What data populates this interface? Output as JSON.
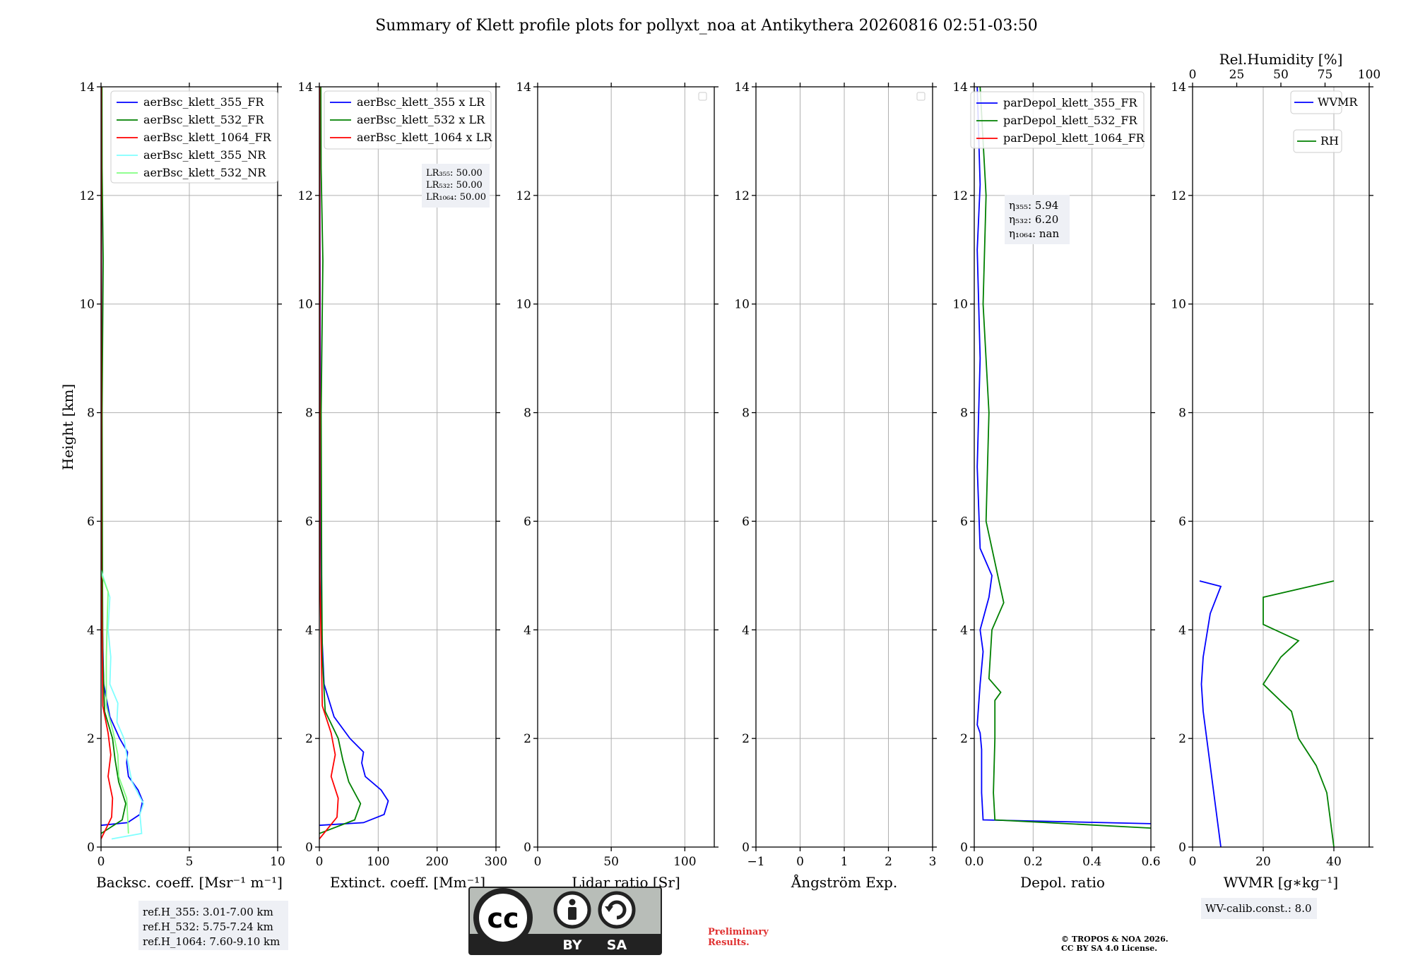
{
  "title": "Summary of Klett profile plots for pollyxt_noa at Antikythera 20260816 02:51-03:50",
  "y_axis_label": "Height [km]",
  "colors": {
    "blue": "#0000ff",
    "green": "#008000",
    "red": "#ff0000",
    "cyan": "#80ffff",
    "lightgreen": "#80ff80",
    "grid": "#b0b0b0"
  },
  "chart_data": [
    {
      "id": "backscatter",
      "type": "line",
      "xlabel": "Backsc. coeff. [Msr⁻¹ m⁻¹]",
      "ylabel": "Height [km]",
      "xlim": [
        0,
        10
      ],
      "ylim": [
        0,
        14
      ],
      "xticks": [
        0,
        5,
        10
      ],
      "yticks": [
        0,
        2,
        4,
        6,
        8,
        10,
        12,
        14
      ],
      "grid": true,
      "legend_position": "upper right",
      "series": [
        {
          "name": "aerBsc_klett_355_FR",
          "color": "#0000ff",
          "points": [
            [
              0.0,
              0.4
            ],
            [
              1.5,
              0.45
            ],
            [
              2.2,
              0.6
            ],
            [
              2.35,
              0.85
            ],
            [
              2.1,
              1.05
            ],
            [
              1.55,
              1.3
            ],
            [
              1.45,
              1.55
            ],
            [
              1.5,
              1.75
            ],
            [
              1.05,
              2.0
            ],
            [
              0.5,
              2.4
            ],
            [
              0.15,
              3.0
            ],
            [
              0.08,
              4.0
            ],
            [
              0.05,
              6.0
            ],
            [
              0.03,
              9.0
            ],
            [
              0.02,
              12.0
            ],
            [
              0.01,
              14.0
            ]
          ]
        },
        {
          "name": "aerBsc_klett_532_FR",
          "color": "#008000",
          "points": [
            [
              0.0,
              0.25
            ],
            [
              1.2,
              0.5
            ],
            [
              1.4,
              0.8
            ],
            [
              1.0,
              1.2
            ],
            [
              0.8,
              1.6
            ],
            [
              0.65,
              2.0
            ],
            [
              0.2,
              2.5
            ],
            [
              0.1,
              3.5
            ],
            [
              0.08,
              5.0
            ],
            [
              0.06,
              8.0
            ],
            [
              0.12,
              10.8
            ],
            [
              0.06,
              12.5
            ],
            [
              0.05,
              14.0
            ]
          ]
        },
        {
          "name": "aerBsc_klett_1064_FR",
          "color": "#ff0000",
          "points": [
            [
              0.0,
              0.15
            ],
            [
              0.6,
              0.55
            ],
            [
              0.65,
              0.9
            ],
            [
              0.4,
              1.3
            ],
            [
              0.55,
              1.7
            ],
            [
              0.4,
              2.1
            ],
            [
              0.1,
              2.6
            ],
            [
              0.02,
              5.0
            ],
            [
              0.01,
              14.0
            ]
          ]
        },
        {
          "name": "aerBsc_klett_355_NR",
          "color": "#80ffff",
          "points": [
            [
              0.6,
              0.15
            ],
            [
              2.3,
              0.25
            ],
            [
              2.2,
              0.6
            ],
            [
              2.4,
              0.8
            ],
            [
              1.75,
              1.2
            ],
            [
              1.5,
              1.6
            ],
            [
              1.3,
              2.0
            ],
            [
              0.9,
              2.3
            ],
            [
              0.95,
              2.65
            ],
            [
              0.5,
              3.0
            ],
            [
              0.55,
              3.5
            ],
            [
              0.4,
              4.0
            ],
            [
              0.5,
              4.6
            ],
            [
              0.2,
              4.9
            ],
            [
              0.0,
              5.1
            ]
          ]
        },
        {
          "name": "aerBsc_klett_532_NR",
          "color": "#80ff80",
          "points": [
            [
              1.55,
              0.25
            ],
            [
              1.5,
              0.6
            ],
            [
              1.45,
              0.9
            ],
            [
              1.0,
              1.3
            ],
            [
              0.95,
              1.7
            ],
            [
              0.7,
              2.1
            ],
            [
              0.3,
              2.6
            ],
            [
              0.3,
              3.5
            ],
            [
              0.35,
              4.2
            ],
            [
              0.4,
              4.7
            ],
            [
              0.05,
              5.0
            ],
            [
              0.0,
              5.1
            ]
          ]
        }
      ],
      "info_box": [
        "ref.H_355: 3.01-7.00 km",
        "ref.H_532: 5.75-7.24 km",
        "ref.H_1064: 7.60-9.10 km"
      ]
    },
    {
      "id": "extinction",
      "type": "line",
      "xlabel": "Extinct. coeff. [Mm⁻¹]",
      "xlim": [
        0,
        300
      ],
      "ylim": [
        0,
        14
      ],
      "xticks": [
        0,
        100,
        200,
        300
      ],
      "yticks": [
        0,
        2,
        4,
        6,
        8,
        10,
        12,
        14
      ],
      "grid": true,
      "legend_position": "upper right",
      "series": [
        {
          "name": "aerBsc_klett_355 x LR",
          "color": "#0000ff",
          "points": [
            [
              0,
              0.4
            ],
            [
              75,
              0.45
            ],
            [
              110,
              0.6
            ],
            [
              117,
              0.85
            ],
            [
              105,
              1.05
            ],
            [
              78,
              1.3
            ],
            [
              72,
              1.55
            ],
            [
              75,
              1.75
            ],
            [
              52,
              2.0
            ],
            [
              25,
              2.4
            ],
            [
              8,
              3.0
            ],
            [
              4,
              4.0
            ],
            [
              2.5,
              6.0
            ],
            [
              1.5,
              9.0
            ],
            [
              1,
              12.0
            ],
            [
              0.5,
              14.0
            ]
          ]
        },
        {
          "name": "aerBsc_klett_532 x LR",
          "color": "#008000",
          "points": [
            [
              0,
              0.25
            ],
            [
              60,
              0.5
            ],
            [
              70,
              0.8
            ],
            [
              50,
              1.2
            ],
            [
              40,
              1.6
            ],
            [
              32,
              2.0
            ],
            [
              10,
              2.5
            ],
            [
              5,
              3.5
            ],
            [
              4,
              5.0
            ],
            [
              3,
              8.0
            ],
            [
              6,
              10.8
            ],
            [
              3,
              12.5
            ],
            [
              2.5,
              14.0
            ]
          ]
        },
        {
          "name": "aerBsc_klett_1064 x LR",
          "color": "#ff0000",
          "points": [
            [
              0,
              0.15
            ],
            [
              30,
              0.55
            ],
            [
              32,
              0.9
            ],
            [
              20,
              1.3
            ],
            [
              27,
              1.7
            ],
            [
              20,
              2.1
            ],
            [
              5,
              2.6
            ],
            [
              1,
              5.0
            ],
            [
              0.5,
              14.0
            ]
          ]
        }
      ],
      "info_box": [
        "LR₃₅₅: 50.00",
        "LR₅₃₂: 50.00",
        "LR₁₀₆₄: 50.00"
      ]
    },
    {
      "id": "lidar_ratio",
      "type": "line",
      "xlabel": "Lidar ratio [Sr]",
      "xlim": [
        0,
        120
      ],
      "ylim": [
        0,
        14
      ],
      "xticks": [
        0,
        50,
        100
      ],
      "yticks": [
        0,
        2,
        4,
        6,
        8,
        10,
        12,
        14
      ],
      "grid": true,
      "series": []
    },
    {
      "id": "angstrom",
      "type": "line",
      "xlabel": "Ångström Exp.",
      "xlim": [
        -1,
        3
      ],
      "ylim": [
        0,
        14
      ],
      "xticks": [
        -1,
        0,
        1,
        2,
        3
      ],
      "yticks": [
        0,
        2,
        4,
        6,
        8,
        10,
        12,
        14
      ],
      "grid": true,
      "series": []
    },
    {
      "id": "depol",
      "type": "line",
      "xlabel": "Depol. ratio",
      "xlim": [
        0,
        0.6
      ],
      "ylim": [
        0,
        14
      ],
      "xticks": [
        0.0,
        0.2,
        0.4,
        0.6
      ],
      "yticks": [
        0,
        2,
        4,
        6,
        8,
        10,
        12,
        14
      ],
      "grid": true,
      "legend_position": "upper right",
      "series": [
        {
          "name": "parDepol_klett_355_FR",
          "color": "#0000ff",
          "points": [
            [
              0.6,
              0.43
            ],
            [
              0.03,
              0.5
            ],
            [
              0.025,
              1.0
            ],
            [
              0.025,
              1.8
            ],
            [
              0.02,
              2.1
            ],
            [
              0.01,
              2.25
            ],
            [
              0.02,
              3.0
            ],
            [
              0.03,
              3.6
            ],
            [
              0.02,
              4.0
            ],
            [
              0.05,
              4.6
            ],
            [
              0.06,
              5.0
            ],
            [
              0.02,
              5.5
            ],
            [
              0.01,
              7.0
            ],
            [
              0.02,
              9.0
            ],
            [
              0.01,
              11.0
            ],
            [
              0.02,
              12.2
            ],
            [
              0.01,
              14.0
            ]
          ]
        },
        {
          "name": "parDepol_klett_532_FR",
          "color": "#008000",
          "points": [
            [
              0.6,
              0.35
            ],
            [
              0.07,
              0.5
            ],
            [
              0.065,
              1.0
            ],
            [
              0.07,
              2.0
            ],
            [
              0.07,
              2.7
            ],
            [
              0.09,
              2.85
            ],
            [
              0.05,
              3.1
            ],
            [
              0.06,
              4.0
            ],
            [
              0.1,
              4.5
            ],
            [
              0.08,
              5.0
            ],
            [
              0.04,
              6.0
            ],
            [
              0.05,
              8.0
            ],
            [
              0.03,
              10.0
            ],
            [
              0.04,
              12.0
            ],
            [
              0.02,
              14.0
            ]
          ]
        },
        {
          "name": "parDepol_klett_1064_FR",
          "color": "#ff0000",
          "points": []
        }
      ],
      "info_box": [
        "η₃₅₅: 5.94",
        "η₅₃₂: 6.20",
        "η₁₀₆₄: nan"
      ]
    },
    {
      "id": "wvmr",
      "type": "line",
      "xlabel": "WVMR [g∗kg⁻¹]",
      "top_xlabel": "Rel.Humidity [%]",
      "xlim": [
        0,
        50
      ],
      "top_xlim": [
        0,
        100
      ],
      "ylim": [
        0,
        14
      ],
      "xticks": [
        0,
        20,
        40
      ],
      "top_xticks": [
        0,
        25,
        50,
        75,
        100
      ],
      "yticks": [
        0,
        2,
        4,
        6,
        8,
        10,
        12,
        14
      ],
      "grid": true,
      "series": [
        {
          "name": "WVMR",
          "color": "#0000ff",
          "points": [
            [
              8,
              0.0
            ],
            [
              7,
              0.5
            ],
            [
              6,
              1.0
            ],
            [
              5,
              1.5
            ],
            [
              4,
              2.0
            ],
            [
              3,
              2.5
            ],
            [
              2.5,
              3.0
            ],
            [
              3,
              3.5
            ],
            [
              4,
              3.9
            ],
            [
              5,
              4.3
            ],
            [
              8,
              4.8
            ],
            [
              2,
              4.9
            ]
          ]
        },
        {
          "name": "RH",
          "color": "#008000",
          "points": [
            [
              40,
              0.0
            ],
            [
              39,
              0.5
            ],
            [
              38,
              1.0
            ],
            [
              35,
              1.5
            ],
            [
              30,
              2.0
            ],
            [
              28,
              2.5
            ],
            [
              20,
              3.0
            ],
            [
              25,
              3.5
            ],
            [
              30,
              3.8
            ],
            [
              20,
              4.1
            ],
            [
              20,
              4.6
            ],
            [
              40,
              4.9
            ]
          ]
        }
      ],
      "info_box": [
        "WV-calib.const.: 8.0"
      ]
    }
  ],
  "cc_badge": {
    "cc": "cc",
    "by": "BY",
    "sa": "SA"
  },
  "preliminary": [
    "Preliminary",
    "Results."
  ],
  "copyright": [
    "© TROPOS & NOA 2026.",
    "CC BY SA 4.0 License."
  ]
}
